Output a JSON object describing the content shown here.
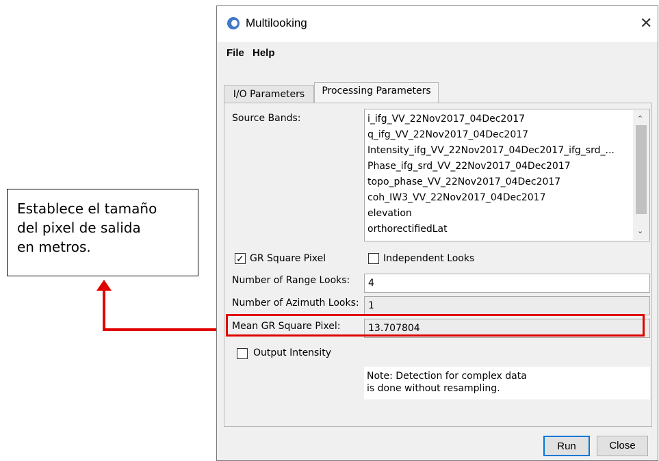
{
  "annotation": {
    "lines": [
      "Establece el tamaño",
      "del pixel de salida",
      "en metros."
    ]
  },
  "window": {
    "title": "Multilooking",
    "close_icon": "close-icon"
  },
  "menu": [
    "File",
    "Help"
  ],
  "tabs": [
    "I/O Parameters",
    "Processing Parameters"
  ],
  "source_bands": {
    "label": "Source Bands:",
    "items": [
      "i_ifg_VV_22Nov2017_04Dec2017",
      "q_ifg_VV_22Nov2017_04Dec2017",
      "Intensity_ifg_VV_22Nov2017_04Dec2017_ifg_srd_...",
      "Phase_ifg_srd_VV_22Nov2017_04Dec2017",
      "topo_phase_VV_22Nov2017_04Dec2017",
      "coh_IW3_VV_22Nov2017_04Dec2017",
      "elevation",
      "orthorectifiedLat"
    ]
  },
  "options": {
    "gr_square_pixel": {
      "label": "GR Square Pixel",
      "checked": true
    },
    "independent_looks": {
      "label": "Independent Looks",
      "checked": false
    }
  },
  "params": {
    "range_looks_label": "Number of Range Looks:",
    "range_looks_value": "4",
    "azimuth_looks_label": "Number of Azimuth Looks:",
    "azimuth_looks_value": "1",
    "mean_gr_label": "Mean GR Square Pixel:",
    "mean_gr_value": "13.707804"
  },
  "output_intensity": {
    "label": "Output Intensity",
    "checked": false
  },
  "note": {
    "line1": "Note: Detection for complex data",
    "line2": "is done without resampling."
  },
  "buttons": {
    "run": "Run",
    "close": "Close"
  },
  "colors": {
    "highlight": "#e00000",
    "default_button_border": "#0078d7"
  }
}
